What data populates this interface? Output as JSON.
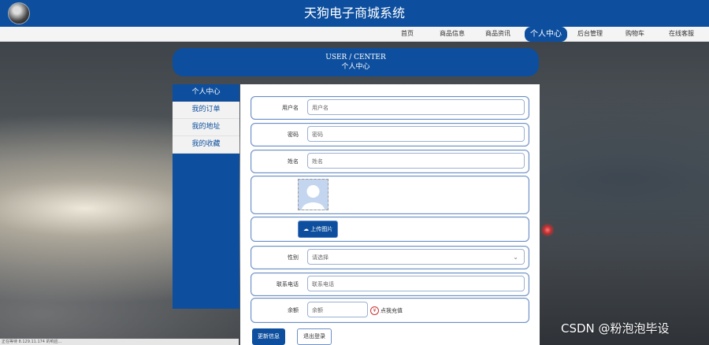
{
  "site": {
    "title": "天狗电子商城系统"
  },
  "nav": {
    "items": [
      {
        "label": "首页",
        "active": false
      },
      {
        "label": "商品信息",
        "active": false
      },
      {
        "label": "商品资讯",
        "active": false
      },
      {
        "label": "个人中心",
        "active": true
      },
      {
        "label": "后台管理",
        "active": false
      },
      {
        "label": "购物车",
        "active": false
      },
      {
        "label": "在线客服",
        "active": false
      }
    ]
  },
  "header": {
    "en": "USER / CENTER",
    "zh": "个人中心"
  },
  "sidebar": {
    "items": [
      {
        "label": "个人中心"
      },
      {
        "label": "我的订单"
      },
      {
        "label": "我的地址"
      },
      {
        "label": "我的收藏"
      }
    ]
  },
  "form": {
    "username": {
      "label": "用户名",
      "placeholder": "用户名"
    },
    "password": {
      "label": "密码",
      "placeholder": "密码"
    },
    "name": {
      "label": "姓名",
      "placeholder": "姓名"
    },
    "upload_label": "上传图片",
    "gender": {
      "label": "性别",
      "placeholder": "请选择"
    },
    "phone": {
      "label": "联系电话",
      "placeholder": "联系电话"
    },
    "balance": {
      "label": "余额",
      "placeholder": "余额",
      "recharge": "点我充值"
    }
  },
  "actions": {
    "update": "更新信息",
    "logout": "退出登录"
  },
  "status": {
    "text": "正在等待 8.129.11.174 的响应..."
  },
  "watermark": "CSDN @粉泡泡毕设",
  "colors": {
    "primary": "#0d4f9e"
  }
}
